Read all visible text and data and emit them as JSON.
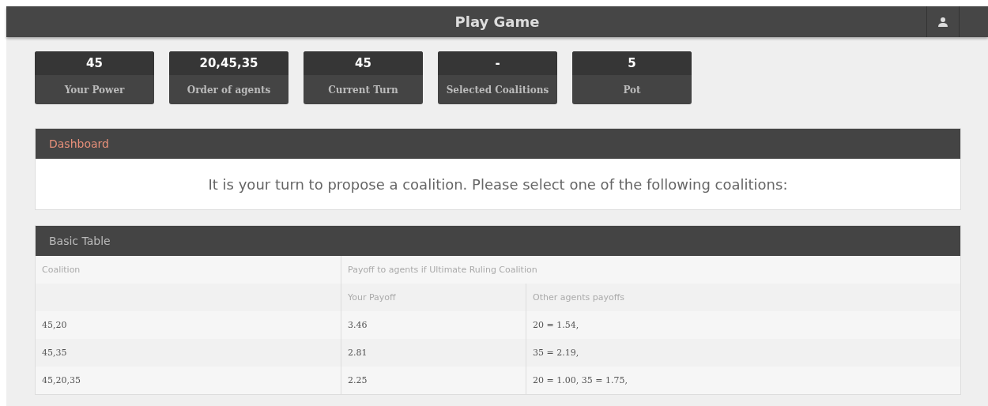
{
  "header": {
    "title": "Play Game"
  },
  "stats": [
    {
      "value": "45",
      "label": "Your Power"
    },
    {
      "value": "20,45,35",
      "label": "Order of agents"
    },
    {
      "value": "45",
      "label": "Current Turn"
    },
    {
      "value": "-",
      "label": "Selected Coalitions"
    },
    {
      "value": "5",
      "label": "Pot"
    }
  ],
  "dashboard": {
    "title": "Dashboard",
    "message": "It is your turn to propose a coalition. Please select one of the following coalitions:"
  },
  "table": {
    "title": "Basic Table",
    "columns": [
      {
        "label": "Coalition"
      },
      {
        "label": "Payoff to agents if Ultimate Ruling Coalition",
        "colspan": 2
      }
    ],
    "subcolumns": [
      "Your Payoff",
      "Other agents payoffs"
    ],
    "rows": [
      [
        "45,20",
        "3.46",
        "20 = 1.54,"
      ],
      [
        "45,35",
        "2.81",
        "35 = 2.19,"
      ],
      [
        "45,20,35",
        "2.25",
        "20 = 1.00, 35 = 1.75,"
      ]
    ]
  }
}
